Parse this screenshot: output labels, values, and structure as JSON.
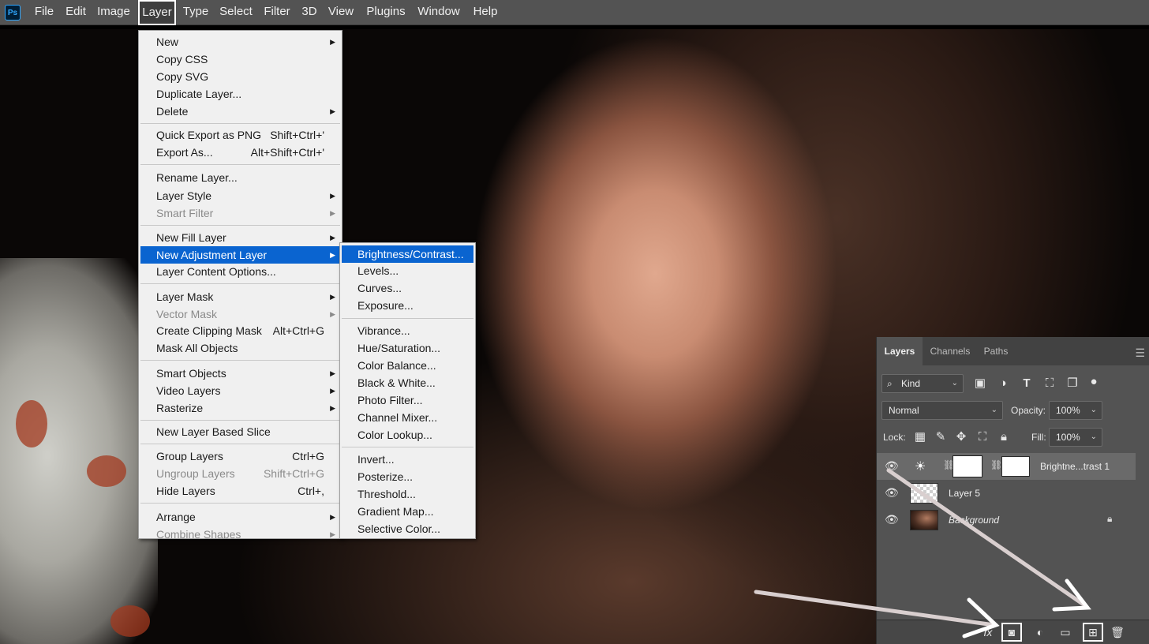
{
  "menubar": {
    "items": [
      "File",
      "Edit",
      "Image",
      "Layer",
      "Type",
      "Select",
      "Filter",
      "3D",
      "View",
      "Plugins",
      "Window",
      "Help"
    ]
  },
  "layer_menu": {
    "items": [
      {
        "label": "New",
        "submenu": true
      },
      {
        "label": "Copy CSS"
      },
      {
        "label": "Copy SVG"
      },
      {
        "label": "Duplicate Layer..."
      },
      {
        "label": "Delete",
        "submenu": true
      },
      {
        "label": "Quick Export as PNG",
        "shortcut": "Shift+Ctrl+'"
      },
      {
        "label": "Export As...",
        "shortcut": "Alt+Shift+Ctrl+'"
      },
      {
        "label": "Rename Layer..."
      },
      {
        "label": "Layer Style",
        "submenu": true
      },
      {
        "label": "Smart Filter",
        "submenu": true,
        "disabled": true
      },
      {
        "label": "New Fill Layer",
        "submenu": true
      },
      {
        "label": "New Adjustment Layer",
        "submenu": true,
        "highlighted": true
      },
      {
        "label": "Layer Content Options..."
      },
      {
        "label": "Layer Mask",
        "submenu": true
      },
      {
        "label": "Vector Mask",
        "submenu": true,
        "disabled": true
      },
      {
        "label": "Create Clipping Mask",
        "shortcut": "Alt+Ctrl+G"
      },
      {
        "label": "Mask All Objects"
      },
      {
        "label": "Smart Objects",
        "submenu": true
      },
      {
        "label": "Video Layers",
        "submenu": true
      },
      {
        "label": "Rasterize",
        "submenu": true
      },
      {
        "label": "New Layer Based Slice"
      },
      {
        "label": "Group Layers",
        "shortcut": "Ctrl+G"
      },
      {
        "label": "Ungroup Layers",
        "shortcut": "Shift+Ctrl+G",
        "disabled": true
      },
      {
        "label": "Hide Layers",
        "shortcut": "Ctrl+,"
      },
      {
        "label": "Arrange",
        "submenu": true
      },
      {
        "label": "Combine Shapes",
        "submenu": true,
        "disabled": true
      }
    ]
  },
  "adjustment_submenu": {
    "items": [
      {
        "label": "Brightness/Contrast...",
        "highlighted": true
      },
      {
        "label": "Levels..."
      },
      {
        "label": "Curves..."
      },
      {
        "label": "Exposure..."
      },
      {
        "label": "Vibrance..."
      },
      {
        "label": "Hue/Saturation..."
      },
      {
        "label": "Color Balance..."
      },
      {
        "label": "Black & White..."
      },
      {
        "label": "Photo Filter..."
      },
      {
        "label": "Channel Mixer..."
      },
      {
        "label": "Color Lookup..."
      },
      {
        "label": "Invert..."
      },
      {
        "label": "Posterize..."
      },
      {
        "label": "Threshold..."
      },
      {
        "label": "Gradient Map..."
      },
      {
        "label": "Selective Color..."
      }
    ]
  },
  "layers_panel": {
    "tabs": [
      "Layers",
      "Channels",
      "Paths"
    ],
    "filter_kind": "Kind",
    "blend_mode": "Normal",
    "opacity_label": "Opacity:",
    "opacity_value": "100%",
    "lock_label": "Lock:",
    "fill_label": "Fill:",
    "fill_value": "100%",
    "layers": [
      {
        "name": "Brightne...trast 1",
        "selected": true
      },
      {
        "name": "Layer 5"
      },
      {
        "name": "Background",
        "locked": true
      }
    ]
  },
  "colors": {
    "menubar_bg": "#535353",
    "menu_bg": "#f0f0f0",
    "menu_highlight": "#0a64d0",
    "panel_bg": "#535353",
    "annotation": "#ffffff"
  }
}
